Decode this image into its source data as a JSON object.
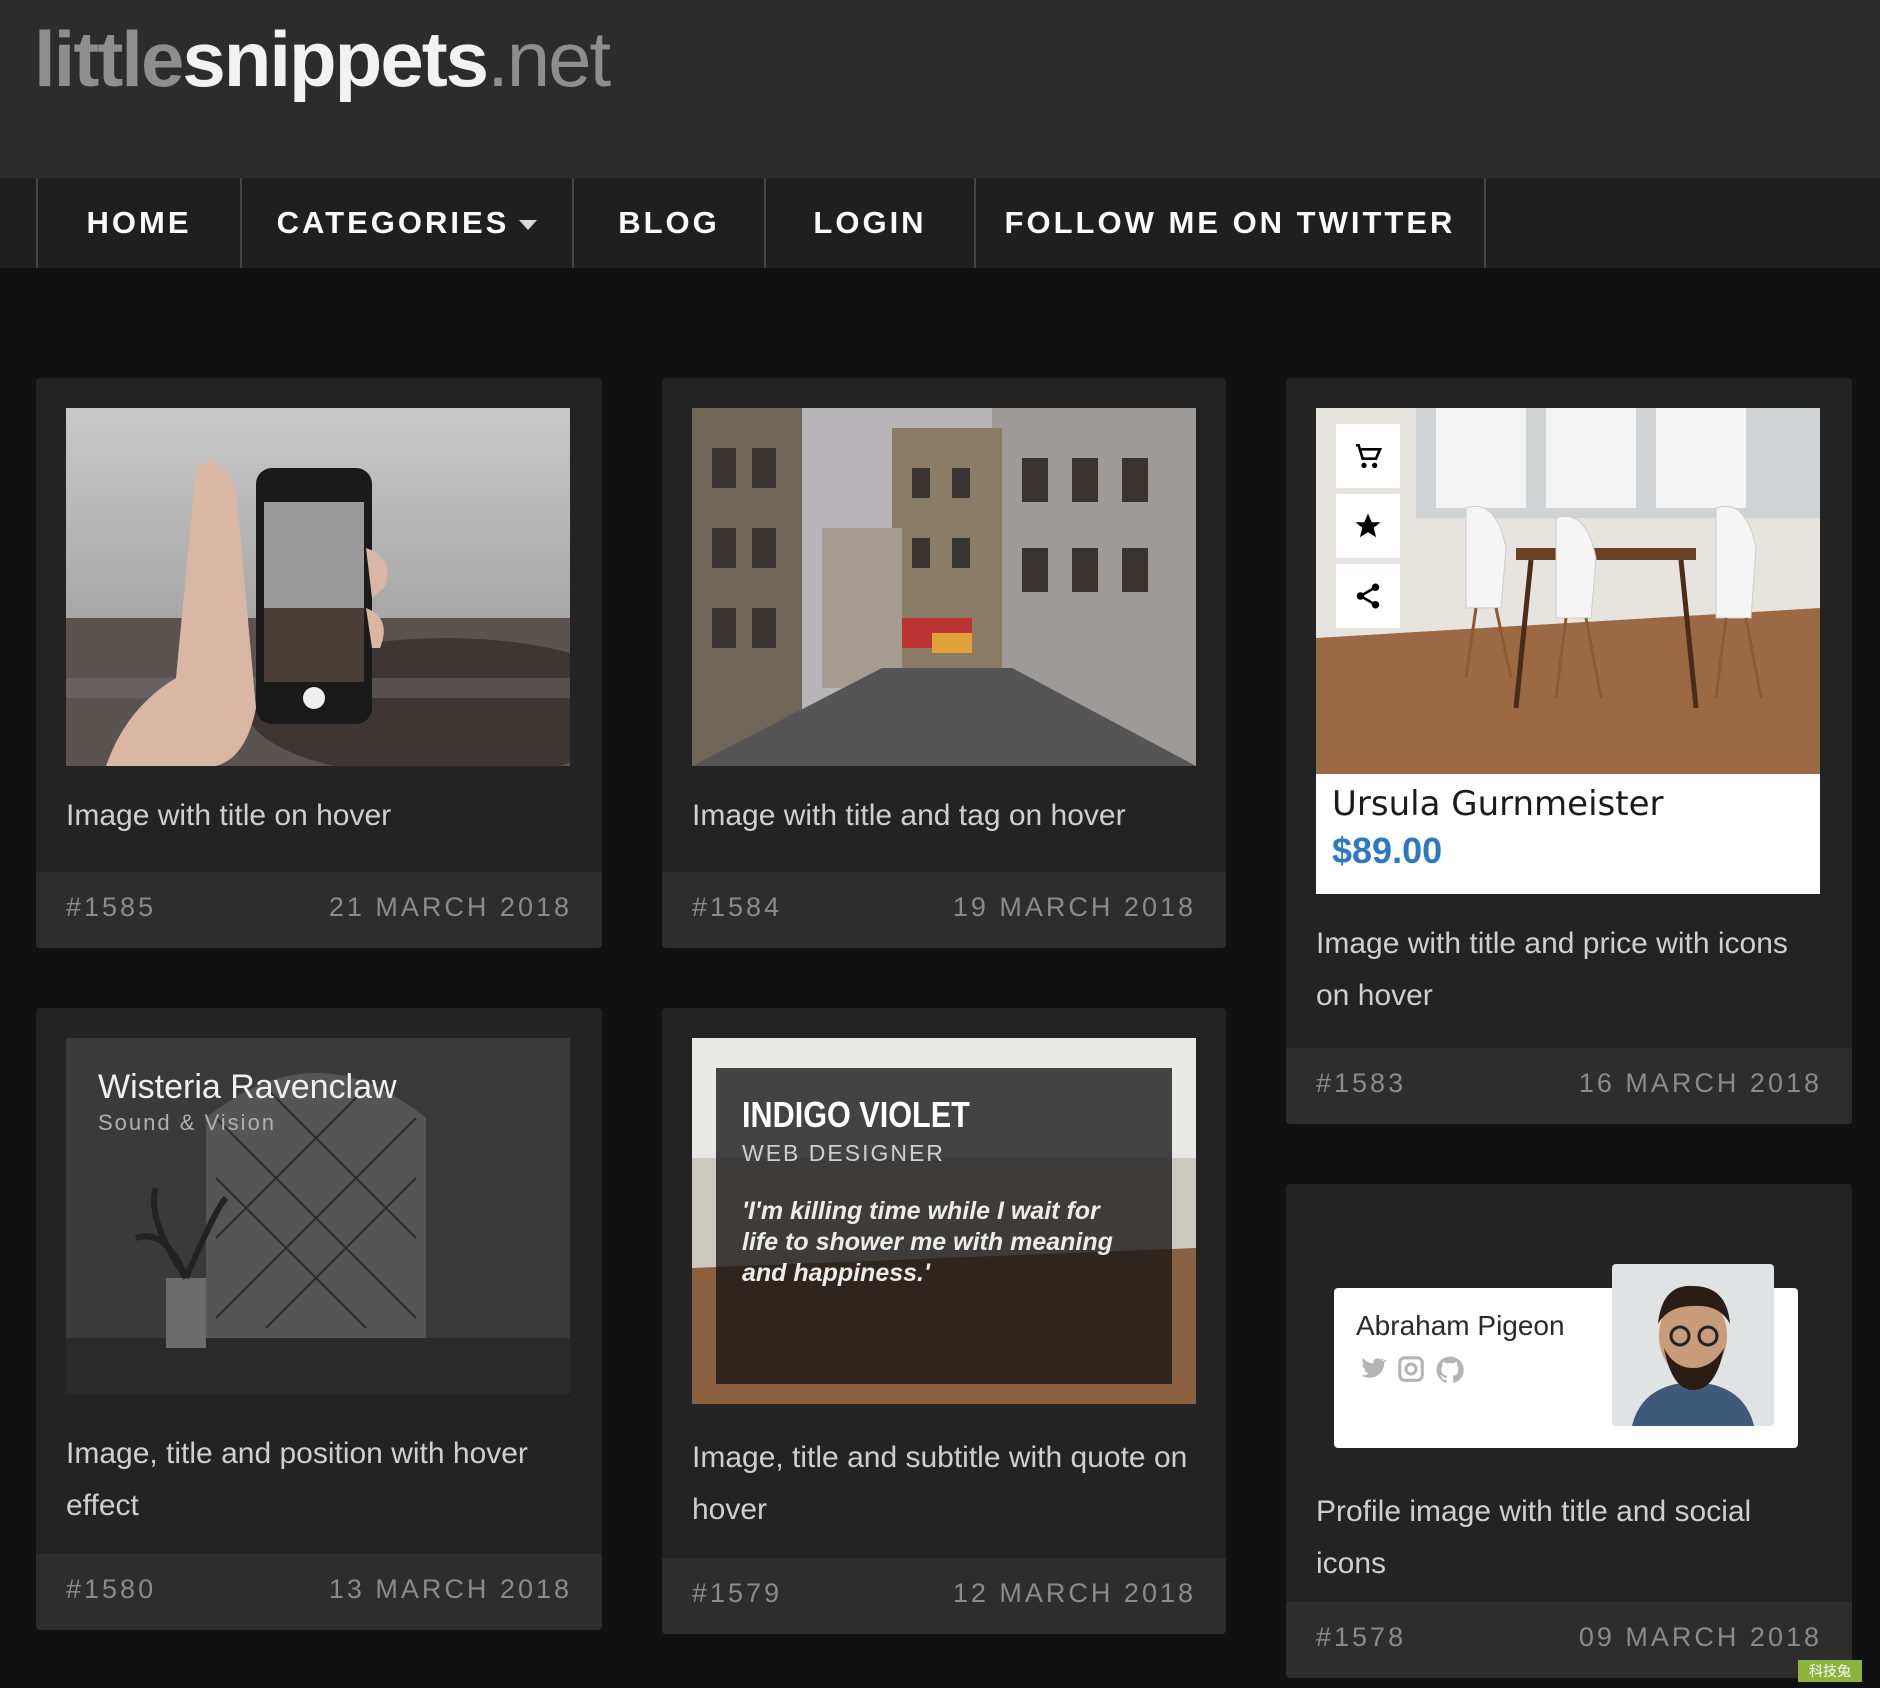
{
  "site": {
    "logo_part1": "little",
    "logo_part2": "snippets",
    "logo_part3": ".net"
  },
  "nav": {
    "items": [
      {
        "label": "HOME"
      },
      {
        "label": "CATEGORIES"
      },
      {
        "label": "BLOG"
      },
      {
        "label": "LOGIN"
      },
      {
        "label": "FOLLOW ME ON TWITTER"
      }
    ]
  },
  "cards": [
    {
      "title": "Image with title on hover",
      "number": "#1585",
      "date": "21 MARCH 2018"
    },
    {
      "title": "Image with title and tag on hover",
      "number": "#1584",
      "date": "19 MARCH 2018"
    },
    {
      "title": "Image with title and price with icons on hover",
      "number": "#1583",
      "date": "16 MARCH 2018",
      "preview": {
        "name": "Ursula Gurnmeister",
        "price": "$89.00",
        "icons": [
          "cart-icon",
          "star-icon",
          "share-icon"
        ]
      }
    },
    {
      "title": "Image, title and position with hover effect",
      "number": "#1580",
      "date": "13 MARCH 2018",
      "preview": {
        "name": "Wisteria Ravenclaw",
        "subtitle": "Sound & Vision"
      }
    },
    {
      "title": "Image, title and subtitle with quote on hover",
      "number": "#1579",
      "date": "12 MARCH 2018",
      "preview": {
        "name": "INDIGO VIOLET",
        "role": "WEB DESIGNER",
        "quote": "'I'm killing time while I wait for life to shower me with meaning and happiness.'"
      }
    },
    {
      "title": "Profile image with title and social icons",
      "number": "#1578",
      "date": "09 MARCH 2018",
      "preview": {
        "name": "Abraham Pigeon",
        "icons": [
          "twitter-icon",
          "instagram-icon",
          "github-icon"
        ]
      }
    }
  ],
  "corner_badge": "科技兔",
  "colors": {
    "accent_price": "#2d78c4",
    "header_bg": "#2c2c2c",
    "page_bg": "#111111",
    "card_bg": "#232323"
  }
}
